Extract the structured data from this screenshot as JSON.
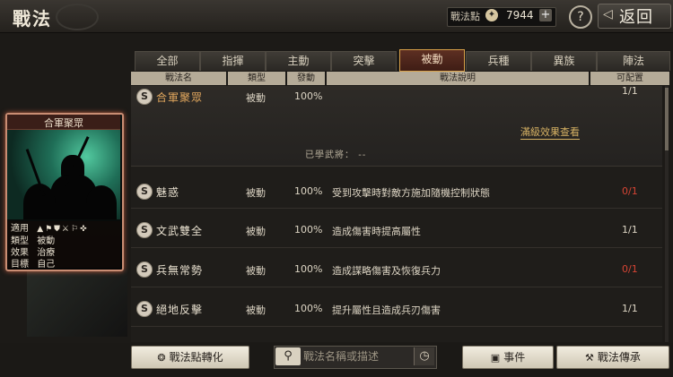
{
  "header": {
    "title": "戰法",
    "points_label": "戰法點",
    "points_value": "7944",
    "plus": "+",
    "help": "?",
    "back_label": "返回"
  },
  "tabs": [
    {
      "label": "全部"
    },
    {
      "label": "指揮"
    },
    {
      "label": "主動"
    },
    {
      "label": "突擊"
    },
    {
      "label": "被動"
    },
    {
      "label": "兵種"
    },
    {
      "label": "異族"
    },
    {
      "label": "陣法"
    }
  ],
  "active_tab": "被動",
  "table": {
    "columns": [
      "戰法名",
      "類型",
      "發動",
      "戰法說明",
      "可配置"
    ],
    "rows": [
      {
        "grade": "S",
        "name": "合軍聚眾",
        "type": "被動",
        "rate": "100%",
        "desc": "",
        "config": "1/1",
        "config_color": "#ddd5c4"
      },
      {
        "grade": "S",
        "name": "魅惑",
        "type": "被動",
        "rate": "100%",
        "desc": "受到攻擊時對敵方施加隨機控制狀態",
        "config": "0/1",
        "config_color": "#d64434"
      },
      {
        "grade": "S",
        "name": "文武雙全",
        "type": "被動",
        "rate": "100%",
        "desc": "造成傷害時提高屬性",
        "config": "1/1",
        "config_color": "#ddd5c4"
      },
      {
        "grade": "S",
        "name": "兵無常勢",
        "type": "被動",
        "rate": "100%",
        "desc": "造成謀略傷害及恢復兵力",
        "config": "0/1",
        "config_color": "#d64434"
      },
      {
        "grade": "S",
        "name": "絕地反擊",
        "type": "被動",
        "rate": "100%",
        "desc": "提升屬性且造成兵刃傷害",
        "config": "1/1",
        "config_color": "#ddd5c4"
      }
    ],
    "expanded": {
      "max_effect_link": "滿級效果查看",
      "learned_label": "已學武將：",
      "learned_value": "--"
    }
  },
  "card": {
    "title": "合軍聚眾",
    "rows": [
      {
        "key": "適用",
        "value": ""
      },
      {
        "key": "類型",
        "value": "被動"
      },
      {
        "key": "效果",
        "value": "治療"
      },
      {
        "key": "目標",
        "value": "自己"
      }
    ]
  },
  "bottom": {
    "convert_label": "戰法點轉化",
    "search_placeholder": "戰法名稱或描述",
    "event_label": "事件",
    "inherit_label": "戰法傳承"
  }
}
